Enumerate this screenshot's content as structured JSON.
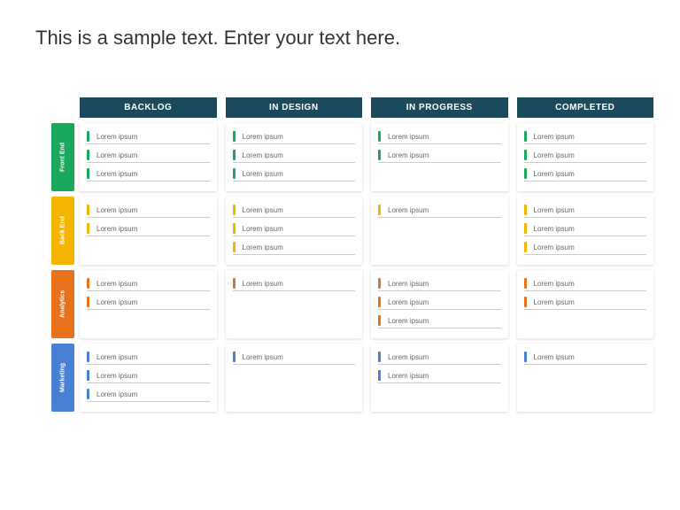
{
  "title": "This is a sample text. Enter your text here.",
  "columns": [
    "BACKLOG",
    "IN DESIGN",
    "IN PROGRESS",
    "COMPLETED"
  ],
  "rows": [
    {
      "label": "Front End",
      "color": "#1aa85c",
      "cells": [
        [
          "Lorem ipsum",
          "Lorem ipsum",
          "Lorem ipsum"
        ],
        [
          "Lorem ipsum",
          "Lorem ipsum",
          "Lorem ipsum"
        ],
        [
          "Lorem ipsum",
          "Lorem ipsum"
        ],
        [
          "Lorem ipsum",
          "Lorem ipsum",
          "Lorem ipsum"
        ]
      ]
    },
    {
      "label": "Back End",
      "color": "#f4b400",
      "cells": [
        [
          "Lorem ipsum",
          "Lorem ipsum"
        ],
        [
          "Lorem ipsum",
          "Lorem ipsum",
          "Lorem ipsum"
        ],
        [
          "Lorem ipsum"
        ],
        [
          "Lorem ipsum",
          "Lorem ipsum",
          "Lorem ipsum"
        ]
      ]
    },
    {
      "label": "Analytics",
      "color": "#e8711c",
      "cells": [
        [
          "Lorem ipsum",
          "Lorem ipsum"
        ],
        [
          "Lorem ipsum"
        ],
        [
          "Lorem ipsum",
          "Lorem ipsum",
          "Lorem ipsum"
        ],
        [
          "Lorem ipsum",
          "Lorem ipsum"
        ]
      ]
    },
    {
      "label": "Marketing",
      "color": "#4a7fd6",
      "cells": [
        [
          "Lorem ipsum",
          "Lorem ipsum",
          "Lorem ipsum"
        ],
        [
          "Lorem ipsum"
        ],
        [
          "Lorem ipsum",
          "Lorem ipsum"
        ],
        [
          "Lorem ipsum"
        ]
      ]
    }
  ]
}
